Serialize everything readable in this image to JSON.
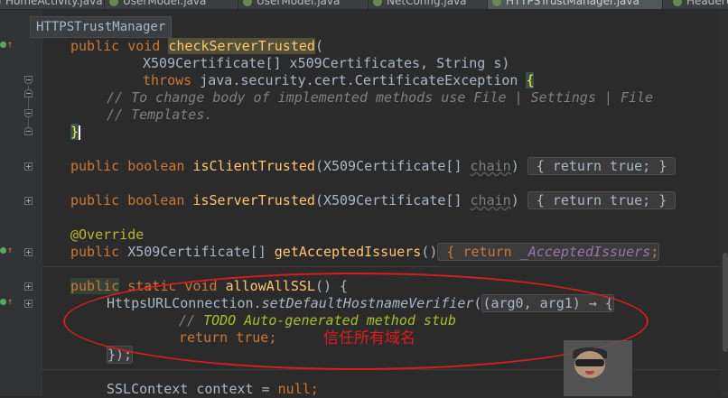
{
  "tabs": [
    {
      "label": "HomeActivity.java"
    },
    {
      "label": "UserModel.java"
    },
    {
      "label": "UserModel.java"
    },
    {
      "label": "NetConfig.java"
    },
    {
      "label": "HTTPSTrustManager.java"
    },
    {
      "label": "HeaderUt"
    }
  ],
  "breadcrumb": "HTTPSTrustManager",
  "code": {
    "l1": {
      "kw": "public void ",
      "fn": "checkServerTrusted",
      "rest": "("
    },
    "l2": "X509Certificate[] x509Certificates, String s)",
    "l3": {
      "kw": "throws ",
      "rest": "java.security.cert.CertificateException ",
      "brace": "{"
    },
    "l4": "// To change body of implemented methods use File | Settings | File",
    "l5": "// Templates.",
    "l6": "}",
    "l7": {
      "kw": "public boolean ",
      "fn": "isClientTrusted",
      "rest": "(X509Certificate[] ",
      "param": "chain",
      "close": ")",
      "folded": " { return true; } "
    },
    "l8": {
      "kw": "public boolean ",
      "fn": "isServerTrusted",
      "rest": "(X509Certificate[] ",
      "param": "chain",
      "close": ")",
      "folded": " { return true; } "
    },
    "l9": "@Override",
    "l10": {
      "kw": "public ",
      "rest": "X509Certificate[] ",
      "fn": "getAcceptedIssuers",
      "paren": "()",
      "folded_kw": " { return ",
      "field": "_AcceptedIssuers",
      "end": ";"
    },
    "l11": {
      "kw1": "public",
      "kw2": " static void ",
      "fn": "allowAllSSL",
      "rest": "() {"
    },
    "l12": {
      "cls": "HttpsURLConnection.",
      "meth": "setDefaultHostnameVerifier",
      "open": "(",
      "lambda": "(arg0, arg1) → {"
    },
    "l13": {
      "prefix": "// ",
      "todo": "TODO Auto-generated method stub"
    },
    "l14": {
      "kw": "return true",
      "end": ";"
    },
    "l15": "});",
    "l16": {
      "rest": "SSLContext context = ",
      "kw": "null",
      "end": ";"
    }
  },
  "annotation_note": "信任所有域名",
  "colors": {
    "keyword": "#cc7832",
    "function": "#ffc66d",
    "comment": "#808080",
    "annotation_ring": "#d81e1e"
  }
}
